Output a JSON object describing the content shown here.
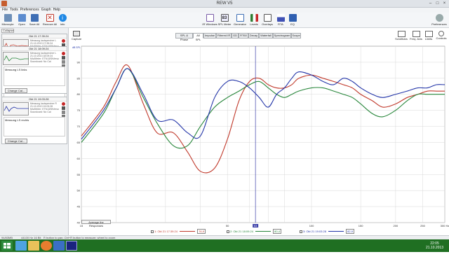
{
  "window": {
    "title": "REW V5",
    "controls": [
      "–",
      "□",
      "×"
    ]
  },
  "menu": [
    "File",
    "Tools",
    "Preferences",
    "Graph",
    "Help"
  ],
  "toolbar": {
    "left": [
      {
        "label": "Microcyte",
        "icon": "microphone-icon"
      },
      {
        "label": "Open",
        "icon": "folder-icon"
      },
      {
        "label": "Save All",
        "icon": "save-icon"
      },
      {
        "label": "Remove All",
        "icon": "delete-icon"
      },
      {
        "label": "Info",
        "icon": "info-icon"
      }
    ],
    "center": [
      {
        "label": "IR Windows",
        "icon": "ir-windows-icon"
      },
      {
        "label": "SPL Meter",
        "icon": "spl-meter-icon",
        "value": "83"
      },
      {
        "label": "Generator",
        "icon": "generator-icon"
      },
      {
        "label": "Levels",
        "icon": "levels-icon"
      },
      {
        "label": "Overlays",
        "icon": "overlays-icon"
      },
      {
        "label": "RTA",
        "icon": "rta-icon"
      },
      {
        "label": "EQ",
        "icon": "eq-icon"
      }
    ],
    "right": {
      "label": "Preferences",
      "icon": "preferences-icon"
    }
  },
  "left_panel": {
    "collapse_label": "Collapse",
    "measurements": [
      {
        "date": "Okt 21 17:39:24",
        "info": [
          "Messung lautsprecher L",
          "21.10.2013 17:39:24",
          "Mic/Meter: ETM-8/StVerso",
          "Soundcard: No Cal"
        ],
        "note": "",
        "change_label": "Change Cal...",
        "color": "#c0392b"
      },
      {
        "date": "Okt 21 18:09:24",
        "info": [
          "Messung lautsprecher L",
          "21.10.2013 18:09:24",
          "Mic/Meter: ETM-8/StVerso",
          "Soundcard: No Cal"
        ],
        "note": "Messung LS links",
        "change_label": "Change Cal...",
        "color": "#27863a"
      },
      {
        "date": "Okt 21 19:03:28",
        "info": [
          "Messung lautsprecher R",
          "21.10.2013 19:03:28",
          "Mic/Meter: ETM-8/StVerso",
          "Soundcard: No Cal"
        ],
        "note": "Messung LS rechts",
        "change_label": "Change Cal...",
        "color": "#2335a8"
      }
    ]
  },
  "capture_label": "Capture",
  "tabs": [
    "SPL & Phase",
    "All SPL",
    "Impulse",
    "Filtered IR",
    "GD",
    "RT60",
    "Decay",
    "Waterfall",
    "Spectrogram",
    "Scope"
  ],
  "active_tab": "All SPL",
  "right_tools": [
    "Scrollbars",
    "Freq. Axis",
    "Limits",
    "Controls"
  ],
  "avg_button": "Average the Responses",
  "legend": [
    {
      "label": "1: Okt 21 17:39:24",
      "value": "76,9",
      "color": "#c0392b"
    },
    {
      "label": "2: Okt 21 18:09:24",
      "value": "80,4",
      "color": "#27863a"
    },
    {
      "label": "3: Okt 21 19:03:28",
      "value": "82,9",
      "color": "#2335a8"
    }
  ],
  "status": {
    "left": "94/83MB",
    "mid": "44100 Hz  16 Bit",
    "hint": "R button to pan; Ctrl+R button to measure; wheel to zoom"
  },
  "clock": {
    "time": "22:05",
    "date": "21.10.2013"
  },
  "chart_data": {
    "type": "line",
    "x_scale": "log",
    "xlim": [
      15,
      300
    ],
    "ylim": [
      40,
      95
    ],
    "x_ticks": [
      15,
      20,
      30,
      40,
      50,
      60,
      70,
      80,
      100,
      150,
      200,
      250,
      300
    ],
    "x_tick_labels": [
      "15",
      "",
      "",
      "",
      "50",
      "",
      "",
      "",
      "100",
      "150",
      "200",
      "250",
      "300 Hz"
    ],
    "y_ticks": [
      40,
      45,
      50,
      55,
      60,
      65,
      70,
      75,
      80,
      85,
      90
    ],
    "y_tick_labels": [
      "40",
      "45",
      "50",
      "55",
      "60",
      "65",
      "70",
      "75",
      "80",
      "85",
      "90"
    ],
    "ylabel": "dB SPL",
    "cursor_x": 63,
    "cursor_label": "63",
    "grid": true,
    "series": [
      {
        "name": "1: Okt 21 17:39:24",
        "color": "#c0392b",
        "x": [
          15,
          18,
          20,
          22,
          25,
          28,
          32,
          36,
          40,
          45,
          50,
          55,
          60,
          65,
          70,
          75,
          80,
          85,
          90,
          100,
          110,
          120,
          130,
          140,
          150,
          165,
          180,
          200,
          220,
          240,
          260,
          280,
          300
        ],
        "y": [
          67,
          76,
          84,
          89,
          77,
          68,
          68,
          62,
          56,
          57,
          66,
          78,
          84,
          85,
          83,
          82,
          82,
          83,
          85,
          86,
          85,
          84,
          83,
          82,
          80,
          78,
          76,
          77,
          79,
          80,
          81,
          81,
          81
        ]
      },
      {
        "name": "2: Okt 21 18:09:24",
        "color": "#27863a",
        "x": [
          15,
          18,
          20,
          22,
          25,
          28,
          32,
          36,
          40,
          45,
          50,
          55,
          60,
          65,
          70,
          75,
          80,
          85,
          90,
          100,
          110,
          120,
          130,
          140,
          150,
          165,
          180,
          200,
          220,
          240,
          260,
          280,
          300
        ],
        "y": [
          65,
          74,
          82,
          88,
          79,
          71,
          64,
          64,
          70,
          76,
          79,
          81,
          83,
          84,
          82,
          80,
          79,
          80,
          81,
          82,
          82,
          81,
          80,
          79,
          77,
          74,
          73,
          75,
          78,
          80,
          80,
          80,
          80
        ]
      },
      {
        "name": "3: Okt 21 19:03:28",
        "color": "#2335a8",
        "x": [
          15,
          18,
          20,
          22,
          25,
          28,
          32,
          36,
          40,
          45,
          50,
          55,
          60,
          65,
          70,
          75,
          80,
          85,
          90,
          100,
          110,
          120,
          130,
          140,
          150,
          165,
          180,
          200,
          220,
          240,
          260,
          280,
          300
        ],
        "y": [
          66,
          75,
          82,
          88,
          80,
          72,
          72,
          68,
          67,
          79,
          84,
          84,
          82,
          79,
          76,
          80,
          82,
          85,
          87,
          86,
          84,
          83,
          85,
          84,
          82,
          80,
          79,
          80,
          81,
          82,
          82,
          83,
          83
        ]
      }
    ]
  }
}
